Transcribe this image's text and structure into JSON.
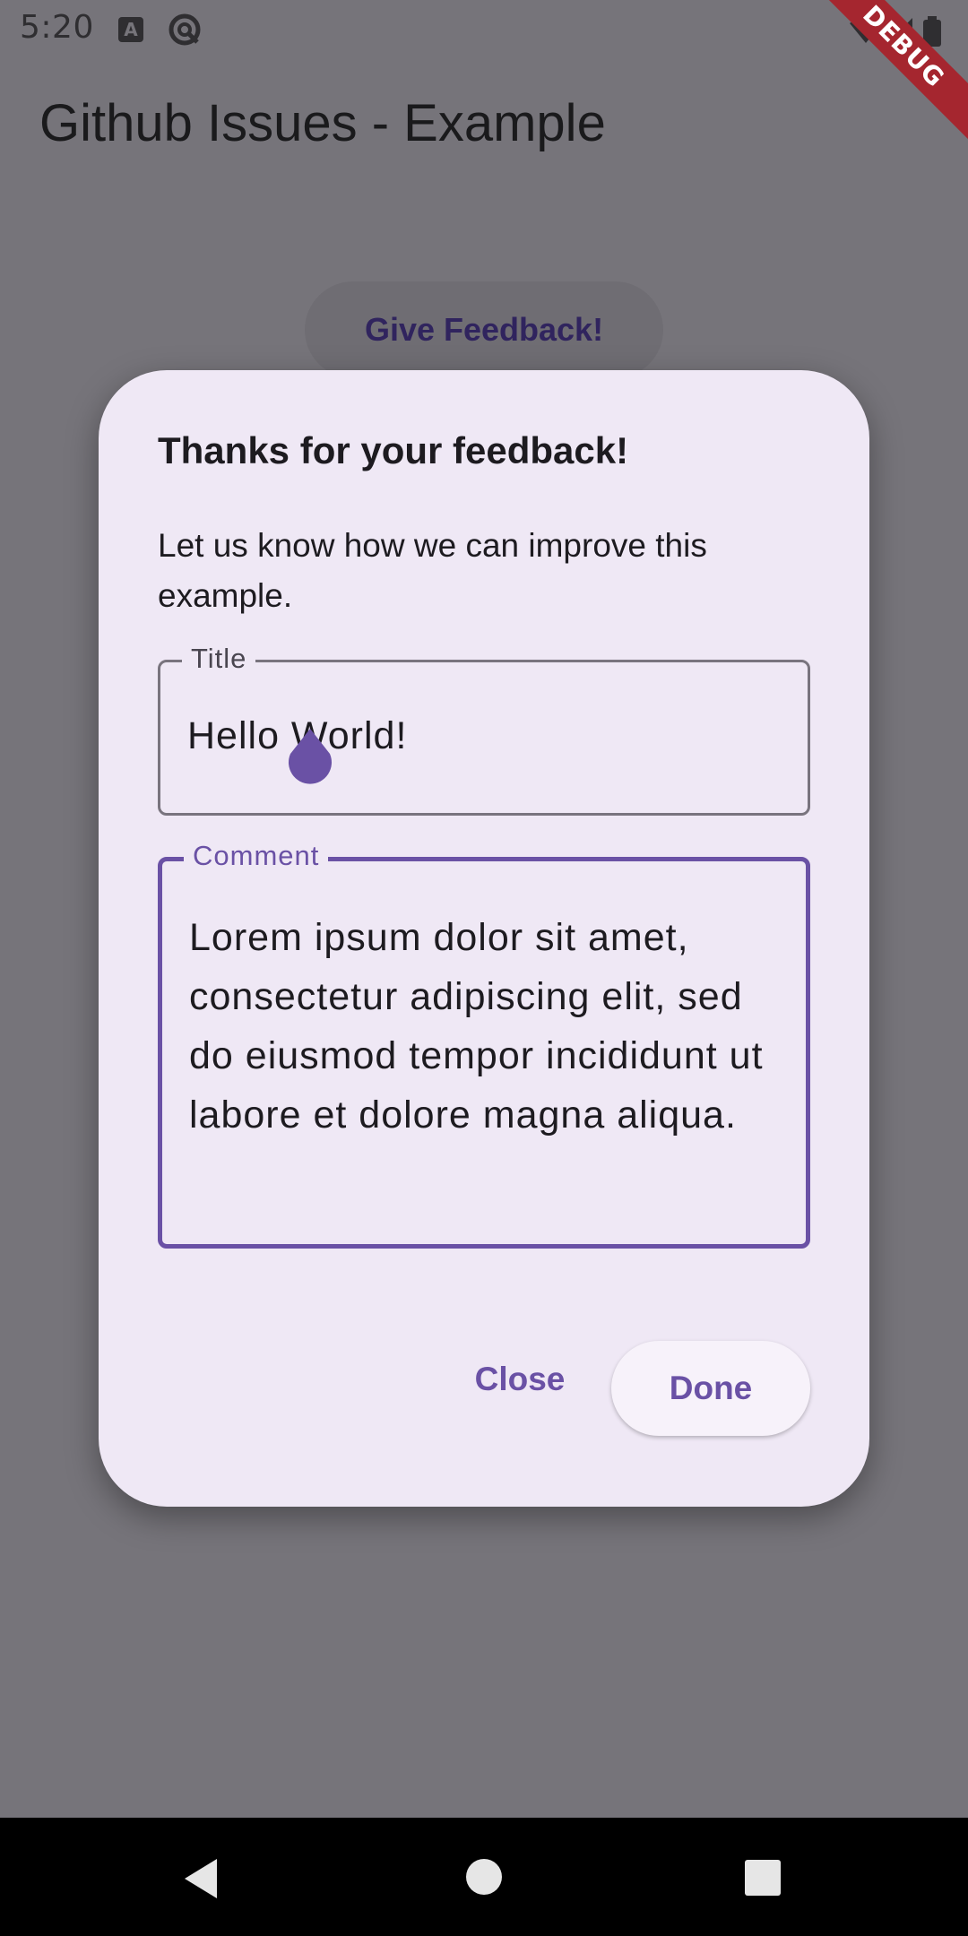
{
  "status_bar": {
    "time": "5:20",
    "icons": [
      "a-notification-icon",
      "sync-icon",
      "wifi-icon",
      "signal-icon",
      "battery-icon"
    ],
    "debug_banner": "DEBUG"
  },
  "app_bar": {
    "title": "Github Issues - Example"
  },
  "main": {
    "feedback_button_label": "Give Feedback!"
  },
  "dialog": {
    "title": "Thanks for your feedback!",
    "body": "Let us know how we can improve this example.",
    "title_field": {
      "label": "Title",
      "value": "Hello World!"
    },
    "comment_field": {
      "label": "Comment",
      "value": "Lorem ipsum dolor sit amet, consectetur adipiscing elit, sed do eiusmod tempor incididunt ut labore et dolore magna aliqua."
    },
    "actions": {
      "close_label": "Close",
      "done_label": "Done"
    }
  },
  "colors": {
    "scrim_background": "#76747a",
    "dialog_surface": "#efe8f5",
    "primary": "#6a51a5",
    "debug_ribbon": "#a5262f",
    "nav_bar": "#000000"
  },
  "nav_bar": {
    "buttons": [
      "back-icon",
      "home-icon",
      "recents-icon"
    ]
  }
}
